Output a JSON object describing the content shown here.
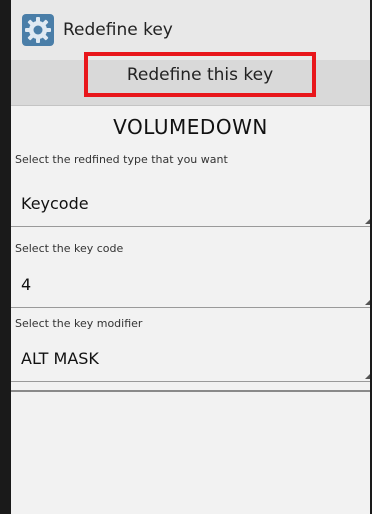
{
  "titlebar": {
    "icon": "gear-icon",
    "title": "Redefine key"
  },
  "redefine_button": {
    "label": "Redefine this key",
    "highlight_color": "#e8161b"
  },
  "key_name": "VOLUMEDOWN",
  "fields": {
    "type": {
      "label": "Select the redfined type that you want",
      "value": "Keycode"
    },
    "keycode": {
      "label": "Select the key code",
      "value": "4"
    },
    "modifier": {
      "label": "Select the key modifier",
      "value": "ALT MASK"
    }
  }
}
